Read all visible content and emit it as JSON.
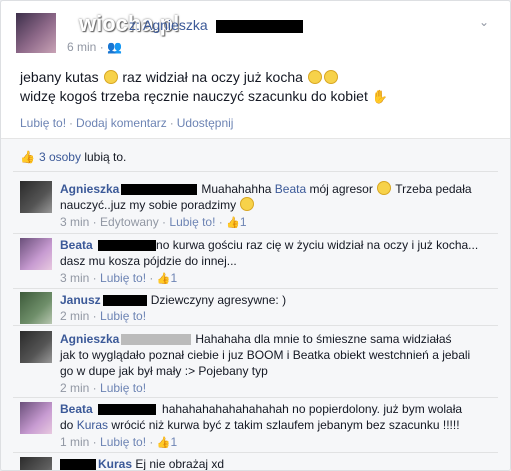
{
  "post": {
    "watermark": "wiocha.pl",
    "author_suffix": "z: Agnieszka",
    "time": "6 min",
    "audience_icon": "friends-icon",
    "line1": "jebany kutas",
    "line1b": "raz widział na oczy już kocha",
    "line2": "widzę kogoś trzeba ręcznie nauczyć szacunku do kobiet",
    "actions": {
      "like": "Lubię to!",
      "comment": "Dodaj komentarz",
      "share": "Udostępnij"
    }
  },
  "likes": {
    "count_text": "3 osoby",
    "suffix_text": "lubią to."
  },
  "comments": [
    {
      "name": "Agnieszka",
      "text1": "Muahahahha",
      "mention": "Beata",
      "text2": "mój agresor",
      "text3": "Trzeba pedała",
      "text4": "nauczyć..juz my sobie poradzimy",
      "time": "3 min",
      "edited": "Edytowany",
      "like": "Lubię to!",
      "count": "1"
    },
    {
      "name": "Beata",
      "text1": "no kurwa gościu raz cię w życiu widział na oczy i już kocha...",
      "text2": "dasz mu kosza pójdzie do innej...",
      "time": "3 min",
      "like": "Lubię to!",
      "count": "1"
    },
    {
      "name": "Janusz",
      "text1": "Dziewczyny agresywne: )",
      "time": "2 min",
      "like": "Lubię to!"
    },
    {
      "name": "Agnieszka",
      "text1": "Hahahaha dla mnie to śmieszne sama widziałaś",
      "text2": "jak to wyglądało poznał ciebie i juz BOOM i Beatka obiekt westchnień a jebali",
      "text3": "go w dupe jak był mały :> Pojebany typ",
      "time": "2 min",
      "like": "Lubię to!"
    },
    {
      "name": "Beata",
      "text1": "hahahahahahahahahah no popierdolony. już bym wolała",
      "text2a": "do",
      "mention": "Kuras",
      "text2b": "wrócić niż kurwa być z takim szlaufem jebanym bez szacunku !!!!!",
      "time": "1 min",
      "like": "Lubię to!",
      "count": "1"
    },
    {
      "name": "Kuras",
      "text1": "Ej nie obrażaj xd"
    }
  ]
}
